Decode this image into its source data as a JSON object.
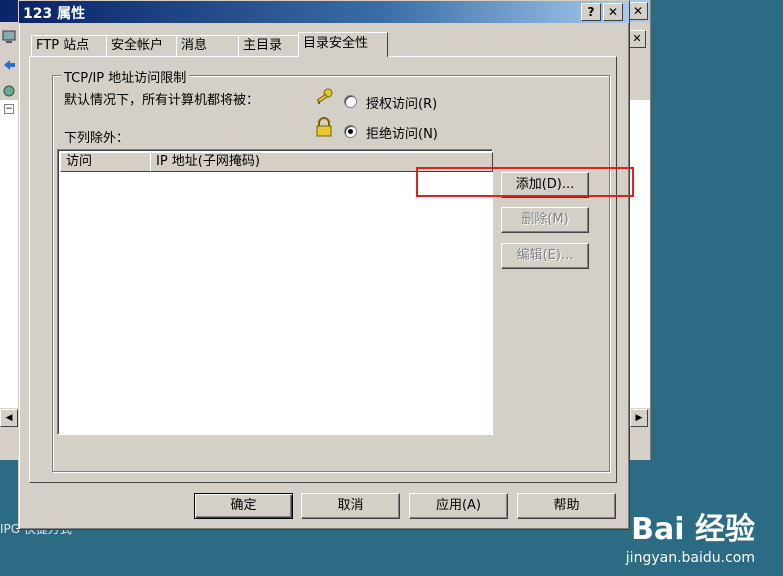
{
  "background": {
    "status_text": "IPG    快捷方式"
  },
  "dialog": {
    "title": "123 属性",
    "help_button": "?",
    "close_button": "✕",
    "tabs": [
      {
        "label": "FTP 站点",
        "active": false
      },
      {
        "label": "安全帐户",
        "active": false
      },
      {
        "label": "消息",
        "active": false
      },
      {
        "label": "主目录",
        "active": false
      },
      {
        "label": "目录安全性",
        "active": true
      }
    ],
    "group": {
      "legend": "TCP/IP 地址访问限制",
      "default_text": "默认情况下，所有计算机都将被：",
      "grant_label": "授权访问(R)",
      "deny_label": "拒绝访问(N)",
      "selected": "deny",
      "except_label": "下列除外：",
      "columns": [
        "访问",
        "IP 地址(子网掩码)"
      ],
      "rows": []
    },
    "side_buttons": {
      "add": "添加(D)...",
      "remove": "删除(M)",
      "edit": "编辑(E)..."
    },
    "footer_buttons": {
      "ok": "确定",
      "cancel": "取消",
      "apply": "应用(A)",
      "help": "帮助"
    }
  },
  "watermark": {
    "logo": "Bai 经验",
    "url": "jingyan.baidu.com"
  },
  "colors": {
    "highlight": "#e0221d",
    "titlebar": "#0a246a",
    "desktop": "#2b6b84"
  }
}
